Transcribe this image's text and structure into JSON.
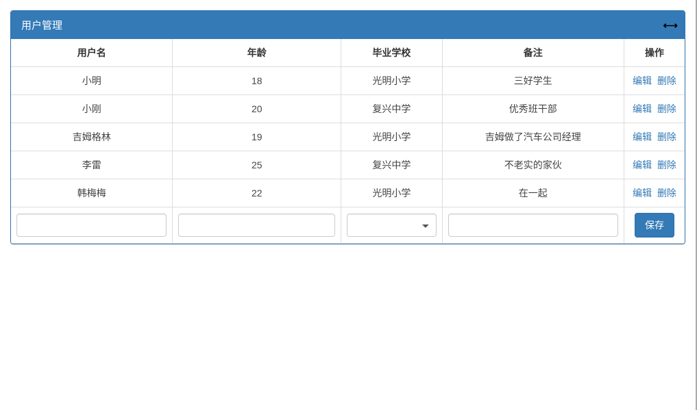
{
  "panel": {
    "title": "用户管理"
  },
  "columns": {
    "name": "用户名",
    "age": "年龄",
    "school": "毕业学校",
    "remark": "备注",
    "ops": "操作"
  },
  "rows": [
    {
      "name": "小明",
      "age": "18",
      "school": "光明小学",
      "remark": "三好学生"
    },
    {
      "name": "小刚",
      "age": "20",
      "school": "复兴中学",
      "remark": "优秀班干部"
    },
    {
      "name": "吉姆格林",
      "age": "19",
      "school": "光明小学",
      "remark": "吉姆做了汽车公司经理"
    },
    {
      "name": "李雷",
      "age": "25",
      "school": "复兴中学",
      "remark": "不老实的家伙"
    },
    {
      "name": "韩梅梅",
      "age": "22",
      "school": "光明小学",
      "remark": "在一起"
    }
  ],
  "actions": {
    "edit": "编辑",
    "delete": "删除",
    "save": "保存"
  },
  "inputs": {
    "name": {
      "value": ""
    },
    "age": {
      "value": ""
    },
    "school": {
      "selected": ""
    },
    "remark": {
      "value": ""
    }
  }
}
